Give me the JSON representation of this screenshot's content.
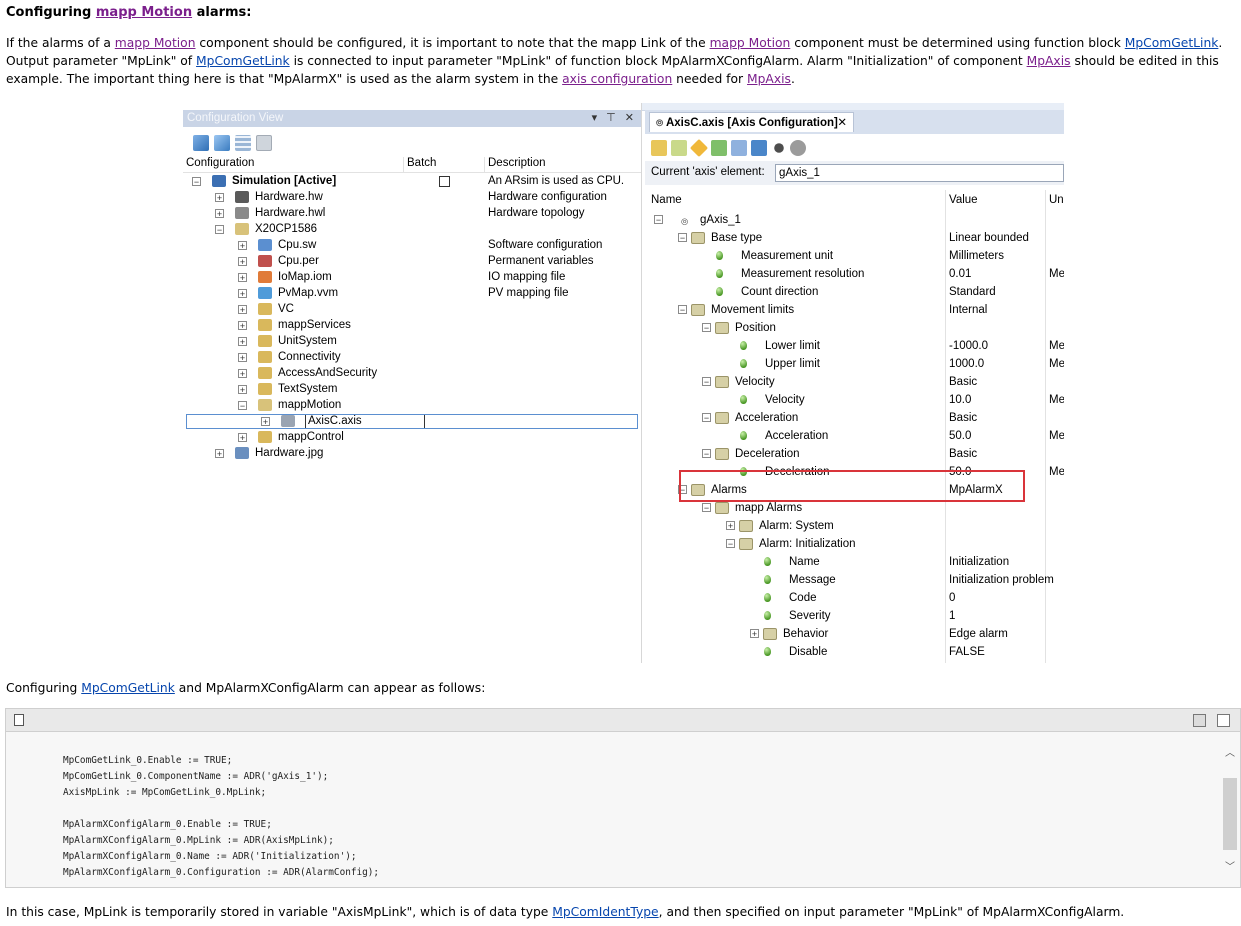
{
  "heading": {
    "prefix": "Configuring ",
    "link": "mapp Motion",
    "suffix": " alarms:"
  },
  "intro": {
    "t1": "If the alarms of a ",
    "l1": "mapp Motion",
    "t2": " component should be configured, it is important to note that the mapp Link of the ",
    "l2": "mapp Motion",
    "t3": " component must be determined using function block ",
    "l3": "MpComGetLink",
    "t4": ". Output parameter \"MpLink\" of ",
    "l4": "MpComGetLink",
    "t5": " is connected to input parameter \"MpLink\" of function block MpAlarmXConfigAlarm. Alarm \"Initialization\" of component ",
    "l5": "MpAxis",
    "t6": " should be edited in this example. The important thing here is that \"MpAlarmX\" is used as the alarm system in the ",
    "l6": "axis configuration",
    "t7": " needed for ",
    "l7": "MpAxis",
    "t8": "."
  },
  "config_view": {
    "title": "Configuration View",
    "title_buttons": "▾ ⊤ ✕",
    "col_configuration": "Configuration",
    "col_batch": "Batch",
    "col_description": "Description",
    "rows": [
      {
        "label": "Simulation [Active]",
        "desc": "An ARsim is used as CPU.",
        "icon": "gears-icon",
        "bold": true
      },
      {
        "label": "Hardware.hw",
        "desc": "Hardware configuration",
        "icon": "hardware-icon"
      },
      {
        "label": "Hardware.hwl",
        "desc": "Hardware topology",
        "icon": "topology-icon"
      },
      {
        "label": "X20CP1586",
        "desc": "",
        "icon": "folder-open-icon"
      },
      {
        "label": "Cpu.sw",
        "desc": "Software configuration",
        "icon": "software-icon"
      },
      {
        "label": "Cpu.per",
        "desc": "Permanent variables",
        "icon": "permanent-icon"
      },
      {
        "label": "IoMap.iom",
        "desc": "IO mapping file",
        "icon": "iomap-icon"
      },
      {
        "label": "PvMap.vvm",
        "desc": "PV mapping file",
        "icon": "pvmap-icon"
      },
      {
        "label": "VC",
        "desc": "",
        "icon": "folder-icon"
      },
      {
        "label": "mappServices",
        "desc": "",
        "icon": "folder-icon"
      },
      {
        "label": "UnitSystem",
        "desc": "",
        "icon": "folder-icon"
      },
      {
        "label": "Connectivity",
        "desc": "",
        "icon": "folder-icon"
      },
      {
        "label": "AccessAndSecurity",
        "desc": "",
        "icon": "folder-icon"
      },
      {
        "label": "TextSystem",
        "desc": "",
        "icon": "folder-icon"
      },
      {
        "label": "mappMotion",
        "desc": "",
        "icon": "folder-open-icon"
      },
      {
        "label": "AxisC.axis",
        "desc": "",
        "icon": "axis-icon"
      },
      {
        "label": "mappControl",
        "desc": "",
        "icon": "folder-icon"
      },
      {
        "label": "Hardware.jpg",
        "desc": "",
        "icon": "image-icon"
      }
    ]
  },
  "axis_config": {
    "tab_label": "AxisC.axis [Axis Configuration]",
    "tab_close": "✕",
    "element_label": "Current 'axis' element:",
    "element_value": "gAxis_1",
    "col_name": "Name",
    "col_value": "Value",
    "col_unit": "Uni",
    "rows": [
      {
        "name": "gAxis_1",
        "value": "",
        "unit": ""
      },
      {
        "name": "Base type",
        "value": "Linear bounded",
        "unit": ""
      },
      {
        "name": "Measurement unit",
        "value": "Millimeters",
        "unit": ""
      },
      {
        "name": "Measurement resolution",
        "value": "0.01",
        "unit": "Me"
      },
      {
        "name": "Count direction",
        "value": "Standard",
        "unit": ""
      },
      {
        "name": "Movement limits",
        "value": "Internal",
        "unit": ""
      },
      {
        "name": "Position",
        "value": "",
        "unit": ""
      },
      {
        "name": "Lower limit",
        "value": "-1000.0",
        "unit": "Me"
      },
      {
        "name": "Upper limit",
        "value": "1000.0",
        "unit": "Me"
      },
      {
        "name": "Velocity",
        "value": "Basic",
        "unit": ""
      },
      {
        "name": "Velocity",
        "value": "10.0",
        "unit": "Me"
      },
      {
        "name": "Acceleration",
        "value": "Basic",
        "unit": ""
      },
      {
        "name": "Acceleration",
        "value": "50.0",
        "unit": "Me"
      },
      {
        "name": "Deceleration",
        "value": "Basic",
        "unit": ""
      },
      {
        "name": "Deceleration",
        "value": "50.0",
        "unit": "Me"
      },
      {
        "name": "Alarms",
        "value": "MpAlarmX",
        "unit": ""
      },
      {
        "name": "mapp Alarms",
        "value": "",
        "unit": ""
      },
      {
        "name": "Alarm: System",
        "value": "",
        "unit": ""
      },
      {
        "name": "Alarm: Initialization",
        "value": "",
        "unit": ""
      },
      {
        "name": "Name",
        "value": "Initialization",
        "unit": ""
      },
      {
        "name": "Message",
        "value": "Initialization problem",
        "unit": ""
      },
      {
        "name": "Code",
        "value": "0",
        "unit": ""
      },
      {
        "name": "Severity",
        "value": "1",
        "unit": ""
      },
      {
        "name": "Behavior",
        "value": "Edge alarm",
        "unit": ""
      },
      {
        "name": "Disable",
        "value": "FALSE",
        "unit": ""
      }
    ]
  },
  "mid": {
    "t1": "Configuring ",
    "l1": "MpComGetLink",
    "t2": " and MpAlarmXConfigAlarm can appear as follows:"
  },
  "code_lines": [
    "MpComGetLink_0.Enable := TRUE;",
    "MpComGetLink_0.ComponentName := ADR('gAxis_1');",
    "AxisMpLink := MpComGetLink_0.MpLink;",
    "",
    "MpAlarmXConfigAlarm_0.Enable := TRUE;",
    "MpAlarmXConfigAlarm_0.MpLink := ADR(AxisMpLink);",
    "MpAlarmXConfigAlarm_0.Name := ADR('Initialization');",
    "MpAlarmXConfigAlarm_0.Configuration := ADR(AlarmConfig);"
  ],
  "outro": {
    "t1": "In this case, MpLink is temporarily stored in variable \"AxisMpLink\", which is of data type ",
    "l1": "MpComIdentType",
    "t2": ", and then specified on input parameter \"MpLink\" of MpAlarmXConfigAlarm."
  },
  "colors": {
    "link": "#0645ad",
    "visited": "#7b1f8c",
    "highlight": "#d9343a"
  }
}
